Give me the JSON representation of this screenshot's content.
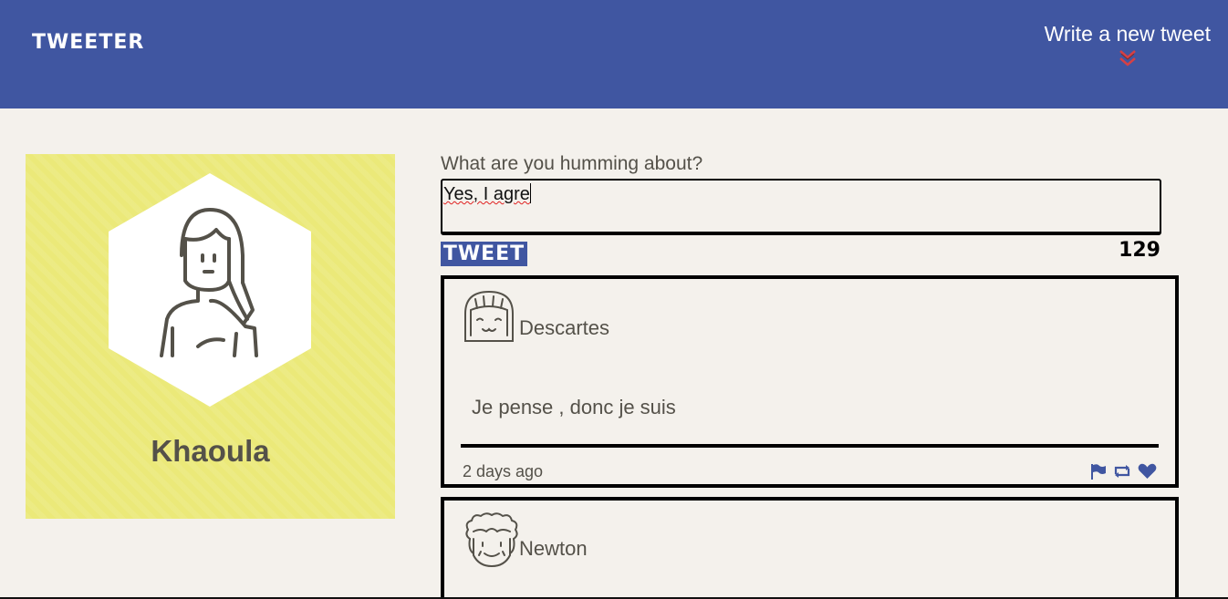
{
  "header": {
    "brand": "TWEETER",
    "compose_label": "Write a new tweet",
    "chevron_icon": "double-chevron-down-icon",
    "colors": {
      "bar": "#4056a1",
      "chevron": "#d64045"
    }
  },
  "profile": {
    "name": "Khaoula",
    "avatar_icon": "girl-avatar-icon",
    "colors": {
      "card": "#ebe979"
    }
  },
  "compose": {
    "prompt": "What are you humming about?",
    "textarea_value": "Yes, I agre",
    "button_label": "TWEET",
    "char_count": "129"
  },
  "tweets": [
    {
      "author": "Descartes",
      "avatar_icon": "smiling-face-avatar-icon",
      "content": "Je pense , donc je suis",
      "time": "2 days ago",
      "actions": [
        "flag-icon",
        "retweet-icon",
        "heart-icon"
      ]
    },
    {
      "author": "Newton",
      "avatar_icon": "curly-hair-avatar-icon"
    }
  ]
}
